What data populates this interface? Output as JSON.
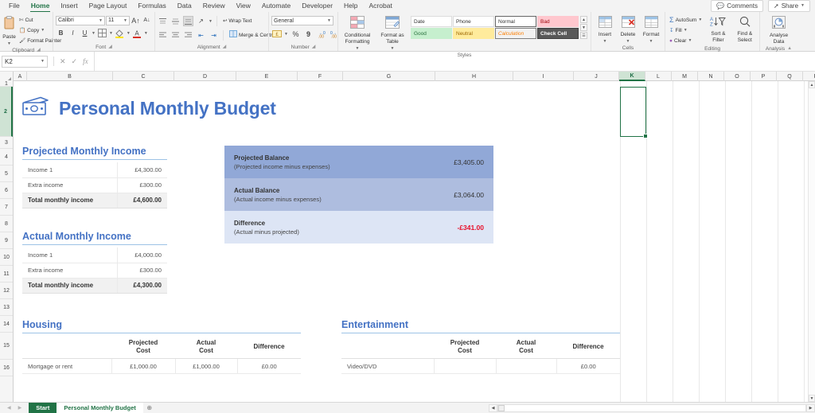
{
  "window": {
    "ribbon_tabs": [
      "File",
      "Home",
      "Insert",
      "Page Layout",
      "Formulas",
      "Data",
      "Review",
      "View",
      "Automate",
      "Developer",
      "Help",
      "Acrobat"
    ],
    "active_tab": "Home",
    "comments_label": "Comments",
    "share_label": "Share"
  },
  "ribbon": {
    "clipboard": {
      "group_label": "Clipboard",
      "paste_label": "Paste",
      "cut_label": "Cut",
      "copy_label": "Copy",
      "format_painter_label": "Format Painter"
    },
    "font": {
      "group_label": "Font",
      "font_name": "Calibri",
      "font_size": "11",
      "grow_label": "A",
      "shrink_label": "A",
      "bold_label": "B",
      "italic_label": "I",
      "underline_label": "U"
    },
    "alignment": {
      "group_label": "Alignment",
      "wrap_text_label": "Wrap Text",
      "merge_label": "Merge & Centre"
    },
    "number": {
      "group_label": "Number",
      "format_value": "General",
      "percent_label": "%",
      "comma_label": "9"
    },
    "styles": {
      "group_label": "Styles",
      "conditional_formatting_label": "Conditional Formatting",
      "format_as_table_label": "Format as Table",
      "gallery": [
        {
          "label": "Date",
          "kind": "plain"
        },
        {
          "label": "Phone",
          "kind": "plain"
        },
        {
          "label": "Normal",
          "kind": "normal"
        },
        {
          "label": "Bad",
          "kind": "bad"
        },
        {
          "label": "Good",
          "kind": "good"
        },
        {
          "label": "Neutral",
          "kind": "neutral"
        },
        {
          "label": "Calculation",
          "kind": "calc"
        },
        {
          "label": "Check Cell",
          "kind": "check"
        }
      ]
    },
    "cells": {
      "group_label": "Cells",
      "insert_label": "Insert",
      "delete_label": "Delete",
      "format_label": "Format"
    },
    "editing": {
      "group_label": "Editing",
      "autosum_label": "AutoSum",
      "fill_label": "Fill",
      "clear_label": "Clear",
      "sort_filter_label": "Sort & Filter",
      "find_select_label": "Find & Select"
    },
    "analysis": {
      "group_label": "Analysis",
      "analyse_data_label": "Analyse Data"
    }
  },
  "formula_bar": {
    "name_box": "K2",
    "formula_value": ""
  },
  "grid": {
    "columns": [
      "A",
      "B",
      "C",
      "D",
      "E",
      "F",
      "G",
      "H",
      "I",
      "J",
      "K",
      "L",
      "M",
      "N",
      "O",
      "P",
      "Q",
      "R"
    ],
    "selected_column": "K",
    "rows": [
      "1",
      "2",
      "3",
      "4",
      "5",
      "6",
      "7",
      "8",
      "9",
      "10",
      "11",
      "12",
      "13",
      "14",
      "15",
      "16"
    ],
    "selected_cell": "K2"
  },
  "sheet": {
    "title": "Personal Monthly Budget",
    "title_icon": "money-icon",
    "projected_income": {
      "heading": "Projected Monthly Income",
      "rows": [
        {
          "label": "Income 1",
          "value": "£4,300.00"
        },
        {
          "label": "Extra income",
          "value": "£300.00"
        }
      ],
      "total_label": "Total monthly income",
      "total_value": "£4,600.00"
    },
    "actual_income": {
      "heading": "Actual Monthly Income",
      "rows": [
        {
          "label": "Income 1",
          "value": "£4,000.00"
        },
        {
          "label": "Extra income",
          "value": "£300.00"
        }
      ],
      "total_label": "Total monthly income",
      "total_value": "£4,300.00"
    },
    "balance": {
      "rows": [
        {
          "title": "Projected Balance",
          "subtitle": "(Projected income minus expenses)",
          "amount": "£3,405.00",
          "negative": false
        },
        {
          "title": "Actual Balance",
          "subtitle": "(Actual income minus expenses)",
          "amount": "£3,064.00",
          "negative": false
        },
        {
          "title": "Difference",
          "subtitle": "(Actual minus projected)",
          "amount": "-£341.00",
          "negative": true
        }
      ]
    },
    "housing": {
      "heading": "Housing",
      "col_projected_1": "Projected",
      "col_projected_2": "Cost",
      "col_actual_1": "Actual",
      "col_actual_2": "Cost",
      "col_difference": "Difference",
      "rows": [
        {
          "label": "Mortgage or rent",
          "projected": "£1,000.00",
          "actual": "£1,000.00",
          "difference": "£0.00"
        }
      ]
    },
    "entertainment": {
      "heading": "Entertainment",
      "col_projected_1": "Projected",
      "col_projected_2": "Cost",
      "col_actual_1": "Actual",
      "col_actual_2": "Cost",
      "col_difference": "Difference",
      "rows": [
        {
          "label": "Video/DVD",
          "projected": "",
          "actual": "",
          "difference": "£0.00"
        }
      ]
    }
  },
  "sheet_tabs": {
    "tabs": [
      {
        "label": "Start",
        "style": "start"
      },
      {
        "label": "Personal Monthly Budget",
        "style": "active"
      }
    ],
    "add_label": "⊕"
  },
  "colors": {
    "accent_blue": "#4472c4",
    "excel_green": "#217346",
    "negative_red": "#e8102a"
  }
}
